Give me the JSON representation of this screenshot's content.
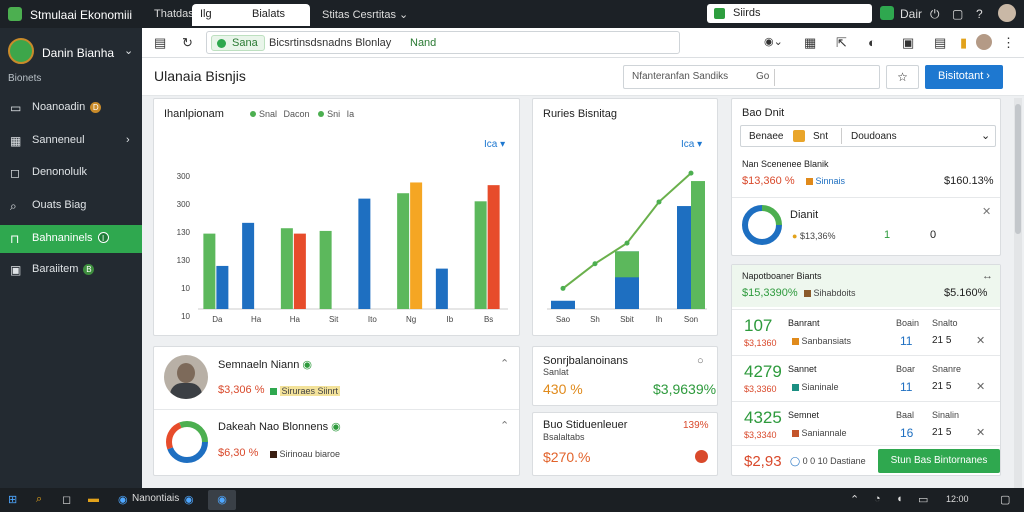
{
  "titlebar": {
    "app_title": "Stmulaai Ekonomiii",
    "tabs": [
      {
        "label": "Thatdas"
      },
      {
        "label": "Ilg"
      },
      {
        "label": "Bialats"
      },
      {
        "label": "Stitas Cesrtitas"
      }
    ],
    "search_text": "Siirds",
    "right_label": "Dair"
  },
  "sidebar": {
    "brand": "Danin Bianha",
    "section": "Bionets",
    "items": [
      {
        "label": "Noanoadin",
        "badge": "D"
      },
      {
        "label": "Sanneneul"
      },
      {
        "label": "Denonolulk"
      },
      {
        "label": "Ouats Biag"
      },
      {
        "label": "Bahnaninels",
        "badge": "I"
      },
      {
        "label": "Baraiitem",
        "badge": "B"
      }
    ]
  },
  "toolbar": {
    "chip": "Sana",
    "url": "Bicsrtinsdsnadns Blonlay",
    "extra": "Nand"
  },
  "page": {
    "title": "Ulanaia Bisnjis",
    "search_placeholder": "Nfanteranfan Sandiks",
    "search_suffix": "Go",
    "primary_button": "Bisitotant"
  },
  "main_chart": {
    "title": "Ihanlpionam",
    "legend": [
      "Snal",
      "Dacon",
      "Sni",
      "Ia"
    ],
    "selector": "Ica",
    "chart_data": {
      "type": "bar",
      "categories": [
        "Da",
        "Ha",
        "Ha",
        "Sit",
        "Ito",
        "Ng",
        "Ib",
        "Bs"
      ],
      "y_ticks": [
        "300",
        "300",
        "130",
        "130",
        "10",
        "10"
      ],
      "series": [
        {
          "values": [
            140,
            null,
            150,
            145,
            0,
            215,
            0,
            200
          ]
        },
        {
          "values": [
            80,
            160,
            0,
            0,
            205,
            0,
            75,
            0
          ]
        },
        {
          "values": [
            0,
            0,
            140,
            0,
            0,
            235,
            0,
            230
          ]
        }
      ]
    }
  },
  "side_chart": {
    "title": "Ruries Bisnitag",
    "selector": "Ica",
    "chart_data": {
      "type": "bar",
      "categories": [
        "Sao",
        "Sh",
        "Sbit",
        "Ih",
        "Son"
      ],
      "bar_values": [
        10,
        0,
        70,
        0,
        125
      ],
      "line_values": [
        25,
        55,
        80,
        130,
        165
      ]
    }
  },
  "profiles": [
    {
      "name": "Semnaeln Niann",
      "value": "$3,306 %",
      "tag": "Siruraes Siinrt"
    },
    {
      "name": "Dakeah Nao Blonnens",
      "value": "$6,30 %",
      "tag": "Sirinoau biaroe"
    }
  ],
  "small_cards": [
    {
      "title": "Sonrjbalanoinans",
      "subtitle": "Sanlat",
      "value_a": "430 %",
      "value_b": "$3,9639%"
    },
    {
      "title": "Buo Stiduenleuer",
      "subtitle": "Bsalaltabs",
      "right": "139%",
      "value": "$270.%"
    }
  ],
  "right_panel_top": {
    "title": "Bao Dnit",
    "filters": [
      "Benaee",
      "Snt",
      "Doudoans"
    ],
    "stat_label": "Nan Scenenee Blanik",
    "stat_value": "$13,360 %",
    "stat_tag": "Sinnais",
    "stat_right": "$160.13%",
    "donut_label": "Dianit",
    "donut_value": "$13,36%",
    "donut_num": "1",
    "donut_num2": "0"
  },
  "right_panel_bottom": {
    "header": "Napotboaner Biants",
    "summary_value": "$15,3390%",
    "summary_tag": "Sihabdoits",
    "summary_right": "$5.160%",
    "rows": [
      {
        "big": "107",
        "sub": "$3,1360",
        "label": "Banrant",
        "tag": "Sanbansiats",
        "h1": "Boain",
        "h2": "Snalto",
        "n1": "11",
        "n2": "21 5"
      },
      {
        "big": "4279",
        "sub": "$3,3360",
        "label": "Sannet",
        "tag": "Sianinale",
        "h1": "Boar",
        "h2": "Snanre",
        "n1": "11",
        "n2": "21 5"
      },
      {
        "big": "4325",
        "sub": "$3,3340",
        "label": "Semnet",
        "tag": "Saniannale",
        "h1": "Baal",
        "h2": "Sinalin",
        "n1": "16",
        "n2": "21 5"
      }
    ],
    "footer_value": "$2,93",
    "footer_tag": "0 0 10 Dastiane",
    "footer_button": "Stun Bas Bintornanes"
  },
  "taskbar": {
    "label": "Nanontiais",
    "clock": "12:00"
  }
}
